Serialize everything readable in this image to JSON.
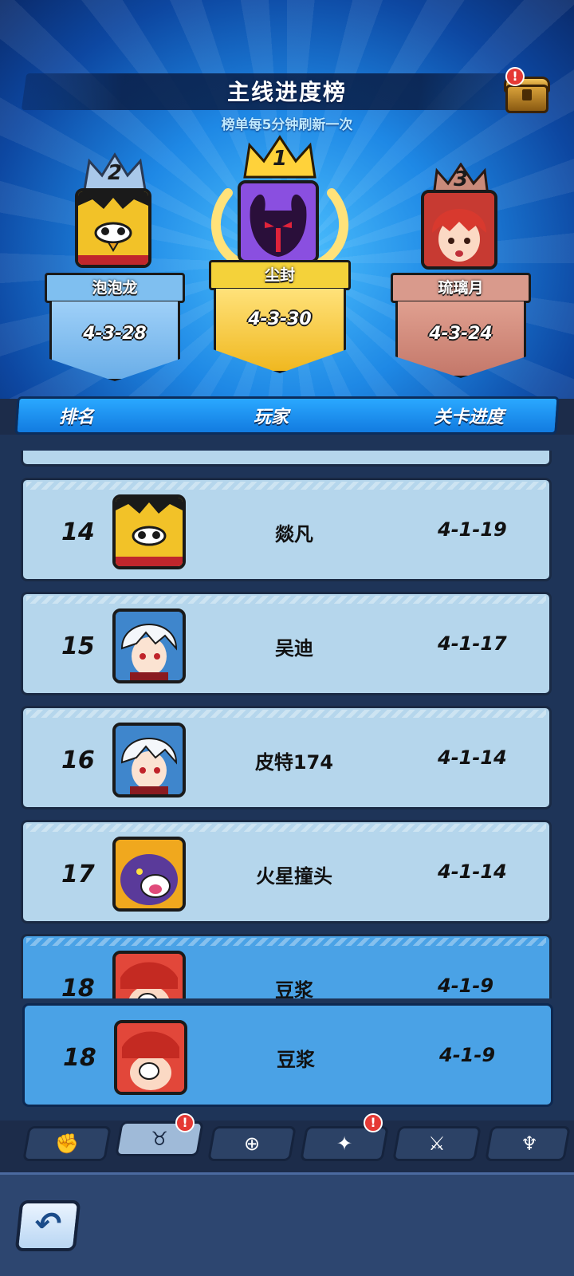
{
  "header": {
    "title": "主线进度榜",
    "subtitle": "榜单每5分钟刷新一次",
    "chest_alert": "!"
  },
  "podium": [
    {
      "place": "2",
      "name": "泡泡龙",
      "progress": "4-3-28",
      "avatar": "yellow-monster-icon"
    },
    {
      "place": "1",
      "name": "尘封",
      "progress": "4-3-30",
      "avatar": "purple-demon-icon"
    },
    {
      "place": "3",
      "name": "琉璃月",
      "progress": "4-3-24",
      "avatar": "red-hair-girl-icon"
    }
  ],
  "columns": {
    "rank": "排名",
    "player": "玩家",
    "progress": "关卡进度"
  },
  "rows": [
    {
      "rank": "14",
      "name": "燚凡",
      "progress": "4-1-19",
      "avatar": "yellow-monster-icon"
    },
    {
      "rank": "15",
      "name": "吴迪",
      "progress": "4-1-17",
      "avatar": "white-hair-boy-icon"
    },
    {
      "rank": "16",
      "name": "皮特174",
      "progress": "4-1-14",
      "avatar": "white-hair-boy-icon"
    },
    {
      "rank": "17",
      "name": "火星撞头",
      "progress": "4-1-14",
      "avatar": "purple-beast-icon"
    },
    {
      "rank": "18",
      "name": "豆浆",
      "progress": "4-1-9",
      "avatar": "red-crab-icon"
    }
  ],
  "self_row": {
    "rank": "18",
    "name": "豆浆",
    "progress": "4-1-9",
    "avatar": "red-crab-icon"
  },
  "tabs": [
    {
      "icon": "fist-icon",
      "glyph": "✊",
      "active": false,
      "alert": ""
    },
    {
      "icon": "horned-skull-icon",
      "glyph": "♉",
      "active": true,
      "alert": "!"
    },
    {
      "icon": "target-icon",
      "glyph": "⊕",
      "active": false,
      "alert": ""
    },
    {
      "icon": "scatter-icon",
      "glyph": "✦",
      "active": false,
      "alert": "!"
    },
    {
      "icon": "sword-icon",
      "glyph": "⚔",
      "active": false,
      "alert": ""
    },
    {
      "icon": "demon-helmet-icon",
      "glyph": "♆",
      "active": false,
      "alert": ""
    }
  ],
  "back_button": {
    "glyph": "↶",
    "icon": "back-arrow-icon"
  }
}
